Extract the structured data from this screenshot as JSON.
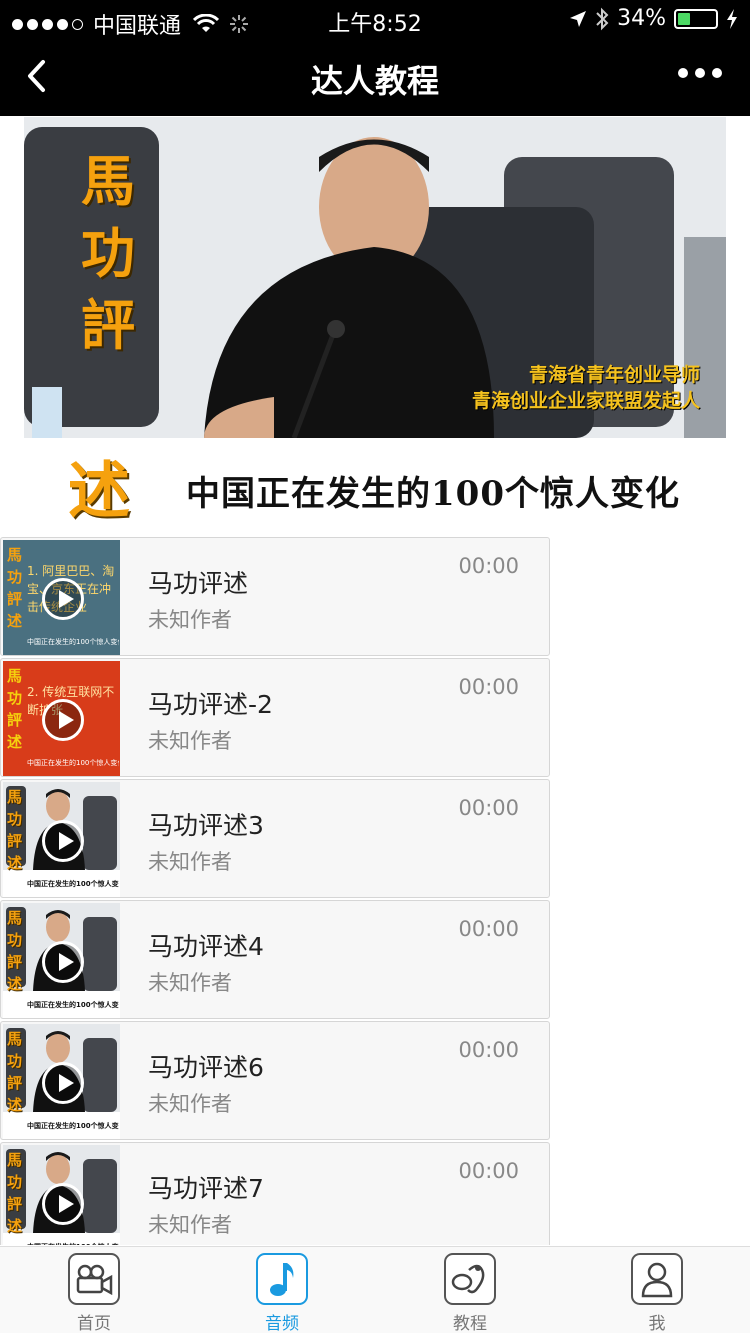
{
  "status_bar": {
    "carrier": "中国联通",
    "time": "上午8:52",
    "battery": "34%",
    "battery_level": 0.34
  },
  "nav": {
    "title": "达人教程"
  },
  "banner": {
    "side_title": [
      "馬",
      "功",
      "評",
      "述"
    ],
    "subtitle_1": "青海省青年创业导师",
    "subtitle_2": "青海创业企业家联盟发起人",
    "headline": "中国正在发生的100个惊人变化"
  },
  "items": [
    {
      "title": "马功评述",
      "author": "未知作者",
      "duration": "00:00",
      "thumb_text": "1. 阿里巴巴、淘宝、京东正在冲击传统企业",
      "thumb_color": "#4a7080"
    },
    {
      "title": "马功评述-2",
      "author": "未知作者",
      "duration": "00:00",
      "thumb_text": "2. 传统互联网不断扩张",
      "thumb_color": "#d83c1a"
    },
    {
      "title": "马功评述3",
      "author": "未知作者",
      "duration": "00:00"
    },
    {
      "title": "马功评述4",
      "author": "未知作者",
      "duration": "00:00"
    },
    {
      "title": "马功评述6",
      "author": "未知作者",
      "duration": "00:00"
    },
    {
      "title": "马功评述7",
      "author": "未知作者",
      "duration": "00:00"
    }
  ],
  "thumb_caption": "中国正在发生的100个惊人变化",
  "tabs": [
    {
      "label": "首页",
      "icon": "video-camera-icon"
    },
    {
      "label": "音频",
      "icon": "music-note-icon",
      "active": true
    },
    {
      "label": "教程",
      "icon": "tutorial-icon"
    },
    {
      "label": "我",
      "icon": "user-profile-icon"
    }
  ],
  "colors": {
    "accent": "#1a9ae0",
    "bar": "#000000",
    "gold": "#f5a10e"
  }
}
